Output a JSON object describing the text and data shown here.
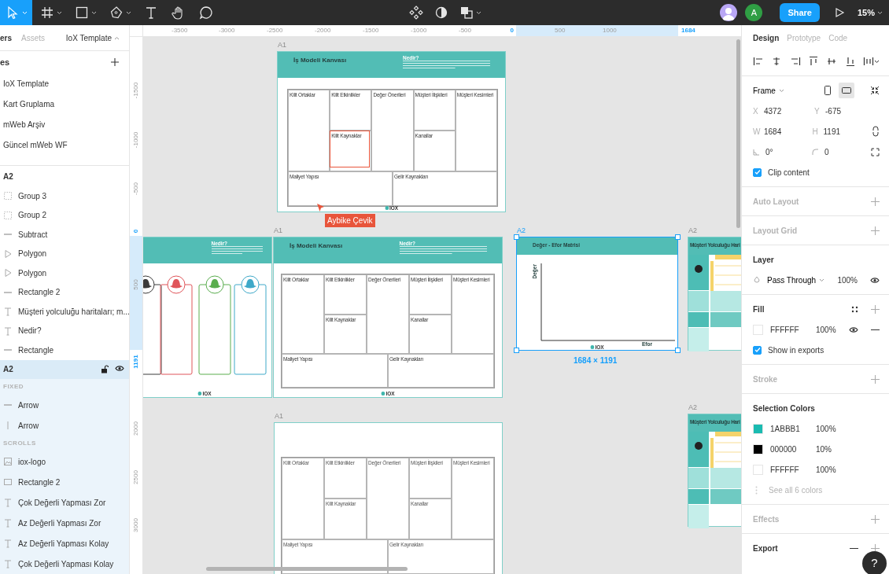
{
  "toolbar": {
    "tools": [
      {
        "kind": "move",
        "selected": true,
        "menu": true
      },
      {
        "kind": "frame",
        "selected": false,
        "menu": true
      },
      {
        "kind": "shape",
        "selected": false,
        "menu": true
      },
      {
        "kind": "pen",
        "selected": false,
        "menu": true
      },
      {
        "kind": "text",
        "selected": false,
        "menu": false
      },
      {
        "kind": "hand",
        "selected": false,
        "menu": false
      },
      {
        "kind": "comment",
        "selected": false,
        "menu": false
      }
    ],
    "center_tools": [
      {
        "kind": "component",
        "menu": false
      },
      {
        "kind": "mask",
        "menu": false
      },
      {
        "kind": "boolean",
        "menu": true
      }
    ],
    "avatars": [
      {
        "kind": "photo",
        "color": "#b9a7f5"
      },
      {
        "kind": "initial",
        "initial": "A",
        "color": "#2f9e44"
      }
    ],
    "share": "Share",
    "zoom": "15%"
  },
  "left_panel": {
    "tabs": [
      {
        "label": "ers",
        "selected": true
      },
      {
        "label": "Assets",
        "selected": false
      }
    ],
    "file": "IoX Template",
    "pages_title": "es",
    "pages": [
      "IoX Template",
      "Kart Gruplama",
      "mWeb Arşiv",
      "Güncel mWeb WF"
    ],
    "layers_title": "A2",
    "layers": [
      {
        "name": "Group 3",
        "kind": "group"
      },
      {
        "name": "Group 2",
        "kind": "group"
      },
      {
        "name": "Subtract",
        "kind": "line"
      },
      {
        "name": "Polygon",
        "kind": "polygon"
      },
      {
        "name": "Polygon",
        "kind": "polygon"
      },
      {
        "name": "Rectangle 2",
        "kind": "line"
      },
      {
        "name": "Müşteri yolculuğu haritaları; m...",
        "kind": "text"
      },
      {
        "name": "Nedir?",
        "kind": "text"
      },
      {
        "name": "Rectangle",
        "kind": "line"
      }
    ],
    "selected_layer": {
      "name": "A2"
    },
    "sections": [
      {
        "title": "FIXED",
        "layers": [
          {
            "name": "Arrow",
            "kind": "line"
          },
          {
            "name": "Arrow",
            "kind": "vline"
          }
        ]
      },
      {
        "title": "SCROLLS",
        "layers": [
          {
            "name": "iox-logo",
            "kind": "image"
          },
          {
            "name": "Rectangle 2",
            "kind": "rect"
          },
          {
            "name": "Çok Değerli Yapması Zor",
            "kind": "text"
          },
          {
            "name": "Az Değerli Yapması Zor",
            "kind": "text"
          },
          {
            "name": "Az Değerli Yapması Kolay",
            "kind": "text"
          },
          {
            "name": "Çok Değerli Yapması Kolay",
            "kind": "text"
          }
        ]
      }
    ]
  },
  "rulers": {
    "x": [
      {
        "label": "-3500",
        "highlight": false
      },
      {
        "label": "-3000",
        "highlight": false
      },
      {
        "label": "-2500",
        "highlight": false
      },
      {
        "label": "-2000",
        "highlight": false
      },
      {
        "label": "-1500",
        "highlight": false
      },
      {
        "label": "-1000",
        "highlight": false
      },
      {
        "label": "-500",
        "highlight": false
      },
      {
        "label": "0",
        "highlight": true
      },
      {
        "label": "500",
        "highlight": false
      },
      {
        "label": "1000",
        "highlight": false
      },
      {
        "label": "1684",
        "highlight": true
      }
    ],
    "y": [
      {
        "label": "-1500",
        "highlight": false
      },
      {
        "label": "-1000",
        "highlight": false
      },
      {
        "label": "-500",
        "highlight": false
      },
      {
        "label": "0",
        "highlight": true
      },
      {
        "label": "500",
        "highlight": false
      },
      {
        "label": "1191",
        "highlight": true
      },
      {
        "label": "2000",
        "highlight": false
      },
      {
        "label": "2500",
        "highlight": false
      },
      {
        "label": "3000",
        "highlight": false
      }
    ]
  },
  "canvas": {
    "frames": [
      {
        "label": "A1",
        "kind": "bmc",
        "selected": false,
        "header": true,
        "title": "İş Modeli Kanvası",
        "note": "Nedir?",
        "cells": [
          "Kilit Ortaklar",
          "Kilit Etkinlikler",
          "Değer Önerileri",
          "Müşteri İlişkileri",
          "Müşteri Kesimleri",
          "Kilit Kaynaklar",
          "Kanallar",
          "Maliyet Yapısı",
          "Gelir Kaynakları"
        ],
        "logo": "IOX"
      },
      {
        "kind": "hats",
        "selected": false,
        "note": "Nedir?",
        "hats": [
          {
            "color": "#3a3a3a"
          },
          {
            "color": "#e0555a"
          },
          {
            "color": "#5aad4e"
          },
          {
            "color": "#3fa9c9"
          }
        ],
        "logo": "IOX"
      },
      {
        "label": "A1",
        "kind": "bmc",
        "selected": false,
        "header": true,
        "title": "İş Modeli Kanvası",
        "note": "Nedir?",
        "cells": [
          "Kilit Ortaklar",
          "Kilit Etkinlikler",
          "Değer Önerileri",
          "Müşteri İlişkileri",
          "Müşteri Kesimleri",
          "Kilit Kaynaklar",
          "Kanallar",
          "Maliyet Yapısı",
          "Gelir Kaynakları"
        ],
        "logo": "IOX"
      },
      {
        "label": "A2",
        "kind": "matrix",
        "selected": true,
        "title": "Değer - Efor Matrisi",
        "y_axis": "Değer",
        "x_axis": "Efor",
        "logo": "IOX"
      },
      {
        "label": "A2",
        "kind": "journey",
        "selected": false,
        "title": "Müşteri Yolculuğu Hari"
      },
      {
        "label": "A2",
        "kind": "journey",
        "selected": false,
        "title": "Müşteri Yolculuğu Hari"
      },
      {
        "label": "A1",
        "kind": "bmc",
        "selected": false,
        "header": false,
        "cells": [
          "Kilit Ortaklar",
          "Kilit Etkinlikler",
          "Değer Önerileri",
          "Müşteri İlişkileri",
          "Müşteri Kesimleri",
          "Kilit Kaynaklar",
          "Kanallar",
          "Maliyet Yapısı",
          "Gelir Kaynakları"
        ]
      }
    ],
    "cursor": {
      "name": "Aybike Çevik"
    },
    "selection_size": "1684 × 1191"
  },
  "design_panel": {
    "tabs": [
      {
        "label": "Design",
        "selected": true
      },
      {
        "label": "Prototype",
        "selected": false
      },
      {
        "label": "Code",
        "selected": false
      }
    ],
    "frame_label": "Frame",
    "orientations": [
      {
        "kind": "portrait",
        "selected": false
      },
      {
        "kind": "landscape",
        "selected": true
      }
    ],
    "position": [
      {
        "label": "X",
        "value": "4372"
      },
      {
        "label": "Y",
        "value": "-675"
      }
    ],
    "size": [
      {
        "label": "W",
        "value": "1684"
      },
      {
        "label": "H",
        "value": "1191"
      }
    ],
    "rotation": "0°",
    "radius": "0",
    "clip_content": {
      "label": "Clip content",
      "checked": true
    },
    "auto_layout": {
      "title": "Auto Layout",
      "active": false
    },
    "layout_grid": {
      "title": "Layout Grid",
      "active": false
    },
    "layer": {
      "title": "Layer",
      "active": true,
      "blend": "Pass Through",
      "opacity": "100%"
    },
    "fill": {
      "title": "Fill",
      "active": true,
      "color": "#ffffff",
      "hex": "FFFFFF",
      "opacity": "100%",
      "show_in_exports": {
        "label": "Show in exports",
        "checked": true
      }
    },
    "stroke": {
      "title": "Stroke",
      "active": false
    },
    "selection_colors": {
      "title": "Selection Colors",
      "active": true,
      "colors": [
        {
          "hex": "1ABBB1",
          "opacity": "100%",
          "color": "#1abbb1"
        },
        {
          "hex": "000000",
          "opacity": "10%",
          "color": "#000000"
        },
        {
          "hex": "FFFFFF",
          "opacity": "100%",
          "color": "#ffffff"
        }
      ],
      "more": "See all 6 colors"
    },
    "effects": {
      "title": "Effects",
      "active": false
    },
    "export": {
      "title": "Export",
      "active": true
    }
  },
  "help": "?"
}
